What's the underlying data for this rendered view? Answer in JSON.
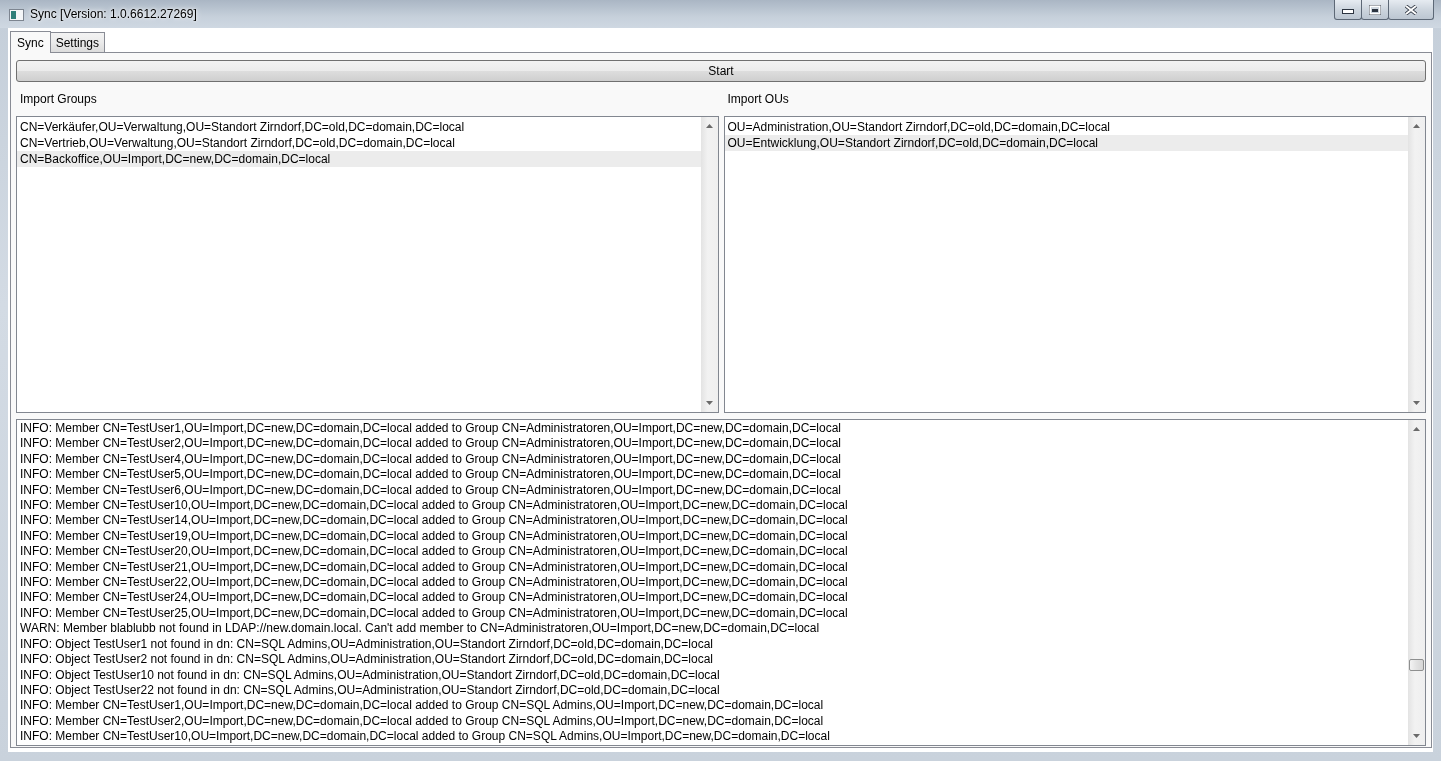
{
  "window": {
    "title": "Sync [Version: 1.0.6612.27269]"
  },
  "tabs": [
    {
      "label": "Sync",
      "selected": true
    },
    {
      "label": "Settings",
      "selected": false
    }
  ],
  "start_button": {
    "label": "Start"
  },
  "import_groups": {
    "label": "Import Groups",
    "items": [
      {
        "text": "CN=Verkäufer,OU=Verwaltung,OU=Standort Zirndorf,DC=old,DC=domain,DC=local",
        "selected": false
      },
      {
        "text": "CN=Vertrieb,OU=Verwaltung,OU=Standort Zirndorf,DC=old,DC=domain,DC=local",
        "selected": false
      },
      {
        "text": "CN=Backoffice,OU=Import,DC=new,DC=domain,DC=local",
        "selected": true
      }
    ]
  },
  "import_ous": {
    "label": "Import OUs",
    "items": [
      {
        "text": "OU=Administration,OU=Standort Zirndorf,DC=old,DC=domain,DC=local",
        "selected": false
      },
      {
        "text": "OU=Entwicklung,OU=Standort Zirndorf,DC=old,DC=domain,DC=local",
        "selected": true
      }
    ]
  },
  "log": {
    "lines": [
      "INFO: Member CN=TestUser1,OU=Import,DC=new,DC=domain,DC=local added to Group CN=Administratoren,OU=Import,DC=new,DC=domain,DC=local",
      "INFO: Member CN=TestUser2,OU=Import,DC=new,DC=domain,DC=local added to Group CN=Administratoren,OU=Import,DC=new,DC=domain,DC=local",
      "INFO: Member CN=TestUser4,OU=Import,DC=new,DC=domain,DC=local added to Group CN=Administratoren,OU=Import,DC=new,DC=domain,DC=local",
      "INFO: Member CN=TestUser5,OU=Import,DC=new,DC=domain,DC=local added to Group CN=Administratoren,OU=Import,DC=new,DC=domain,DC=local",
      "INFO: Member CN=TestUser6,OU=Import,DC=new,DC=domain,DC=local added to Group CN=Administratoren,OU=Import,DC=new,DC=domain,DC=local",
      "INFO: Member CN=TestUser10,OU=Import,DC=new,DC=domain,DC=local added to Group CN=Administratoren,OU=Import,DC=new,DC=domain,DC=local",
      "INFO: Member CN=TestUser14,OU=Import,DC=new,DC=domain,DC=local added to Group CN=Administratoren,OU=Import,DC=new,DC=domain,DC=local",
      "INFO: Member CN=TestUser19,OU=Import,DC=new,DC=domain,DC=local added to Group CN=Administratoren,OU=Import,DC=new,DC=domain,DC=local",
      "INFO: Member CN=TestUser20,OU=Import,DC=new,DC=domain,DC=local added to Group CN=Administratoren,OU=Import,DC=new,DC=domain,DC=local",
      "INFO: Member CN=TestUser21,OU=Import,DC=new,DC=domain,DC=local added to Group CN=Administratoren,OU=Import,DC=new,DC=domain,DC=local",
      "INFO: Member CN=TestUser22,OU=Import,DC=new,DC=domain,DC=local added to Group CN=Administratoren,OU=Import,DC=new,DC=domain,DC=local",
      "INFO: Member CN=TestUser24,OU=Import,DC=new,DC=domain,DC=local added to Group CN=Administratoren,OU=Import,DC=new,DC=domain,DC=local",
      "INFO: Member CN=TestUser25,OU=Import,DC=new,DC=domain,DC=local added to Group CN=Administratoren,OU=Import,DC=new,DC=domain,DC=local",
      "WARN: Member blablubb not found in LDAP://new.domain.local. Can't add member to CN=Administratoren,OU=Import,DC=new,DC=domain,DC=local",
      "INFO: Object TestUser1 not found in dn: CN=SQL Admins,OU=Administration,OU=Standort Zirndorf,DC=old,DC=domain,DC=local",
      "INFO: Object TestUser2 not found in dn: CN=SQL Admins,OU=Administration,OU=Standort Zirndorf,DC=old,DC=domain,DC=local",
      "INFO: Object TestUser10 not found in dn: CN=SQL Admins,OU=Administration,OU=Standort Zirndorf,DC=old,DC=domain,DC=local",
      "INFO: Object TestUser22 not found in dn: CN=SQL Admins,OU=Administration,OU=Standort Zirndorf,DC=old,DC=domain,DC=local",
      "INFO: Member CN=TestUser1,OU=Import,DC=new,DC=domain,DC=local added to Group CN=SQL Admins,OU=Import,DC=new,DC=domain,DC=local",
      "INFO: Member CN=TestUser2,OU=Import,DC=new,DC=domain,DC=local added to Group CN=SQL Admins,OU=Import,DC=new,DC=domain,DC=local",
      "INFO: Member CN=TestUser10,OU=Import,DC=new,DC=domain,DC=local added to Group CN=SQL Admins,OU=Import,DC=new,DC=domain,DC=local"
    ]
  }
}
